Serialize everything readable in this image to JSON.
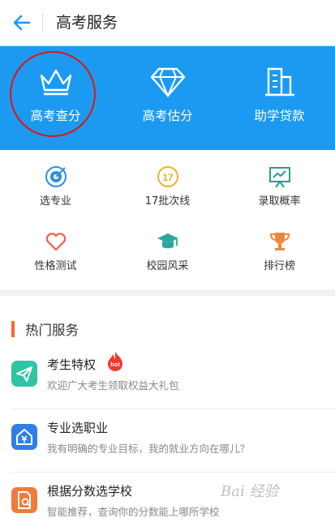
{
  "header": {
    "title": "高考服务"
  },
  "hero": {
    "items": [
      {
        "label": "高考查分",
        "icon": "crown-icon"
      },
      {
        "label": "高考估分",
        "icon": "diamond-icon"
      },
      {
        "label": "助学贷款",
        "icon": "building-icon"
      }
    ]
  },
  "grid": {
    "items": [
      {
        "label": "选专业",
        "icon": "target-icon"
      },
      {
        "label": "17批次线",
        "icon": "batch-17-icon",
        "icon_text": "17"
      },
      {
        "label": "录取概率",
        "icon": "chart-board-icon"
      },
      {
        "label": "性格测试",
        "icon": "heart-icon"
      },
      {
        "label": "校园风采",
        "icon": "graduation-cap-icon"
      },
      {
        "label": "排行榜",
        "icon": "trophy-icon"
      }
    ]
  },
  "hot_services": {
    "title": "热门服务",
    "items": [
      {
        "title": "考生特权",
        "subtitle": "欢迎广大考生领取权益大礼包",
        "badge": "hot",
        "icon_color": "#2ec5a5"
      },
      {
        "title": "专业选职业",
        "subtitle": "我有明确的专业目标，我的就业方向在哪儿？",
        "icon_color": "#2f7fe6"
      },
      {
        "title": "根据分数选学校",
        "subtitle": "智能推荐，查询你的分数能上哪所学校",
        "icon_color": "#f47a3a"
      }
    ]
  },
  "colors": {
    "hero_bg": "#1c9af2",
    "accent": "#f36d2c",
    "annotation": "#e3140f"
  },
  "watermark": "Bai 经验"
}
